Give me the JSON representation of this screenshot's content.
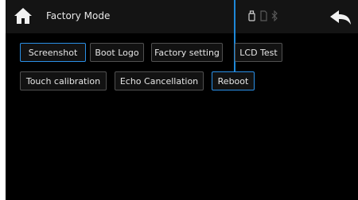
{
  "header": {
    "title": "Factory Mode",
    "icons": [
      "home-icon",
      "usb-icon",
      "sd-card-icon",
      "bluetooth-icon",
      "back-arrow-icon"
    ]
  },
  "buttons": {
    "row1": [
      "Screenshot",
      "Boot Logo",
      "Factory setting",
      "LCD Test"
    ],
    "row2": [
      "Touch calibration",
      "Echo Cancellation",
      "Reboot"
    ]
  },
  "colors": {
    "accent": "#2a8fe6",
    "background": "#000000",
    "topbar": "#141414",
    "button_border": "#505050"
  }
}
